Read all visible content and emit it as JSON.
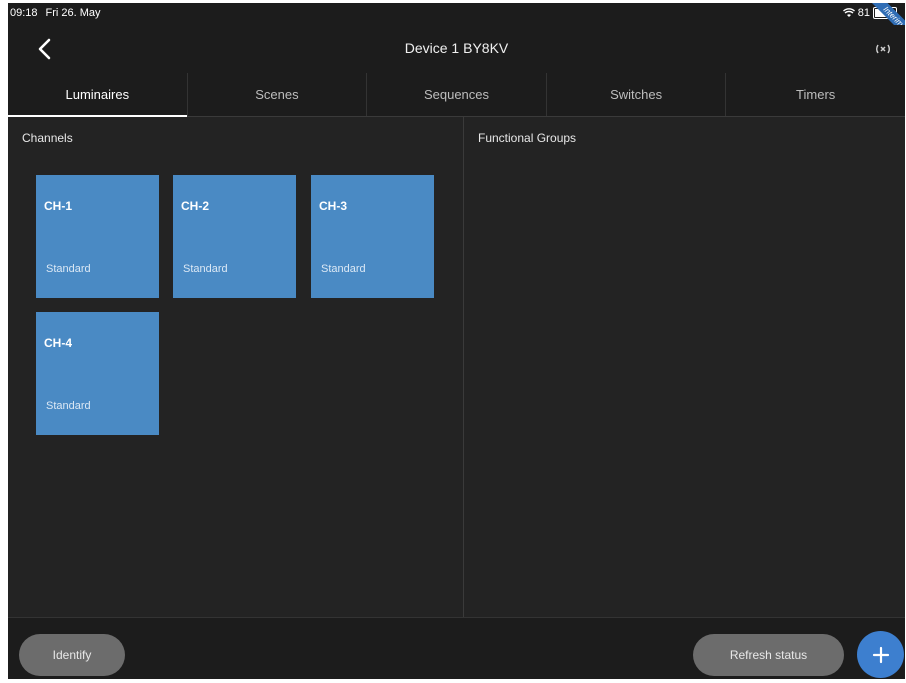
{
  "status_bar": {
    "time": "09:18",
    "date": "Fri 26. May",
    "battery": "81",
    "banner": "Interim"
  },
  "header": {
    "title": "Device 1 BY8KV"
  },
  "tabs": [
    {
      "label": "Luminaires",
      "active": true
    },
    {
      "label": "Scenes",
      "active": false
    },
    {
      "label": "Sequences",
      "active": false
    },
    {
      "label": "Switches",
      "active": false
    },
    {
      "label": "Timers",
      "active": false
    }
  ],
  "channels": {
    "title": "Channels",
    "items": [
      {
        "name": "CH-1",
        "type": "Standard"
      },
      {
        "name": "CH-2",
        "type": "Standard"
      },
      {
        "name": "CH-3",
        "type": "Standard"
      },
      {
        "name": "CH-4",
        "type": "Standard"
      }
    ]
  },
  "functional_groups": {
    "title": "Functional Groups"
  },
  "bottom": {
    "identify_label": "Identify",
    "refresh_label": "Refresh status",
    "add_label": "+"
  },
  "colors": {
    "background": "#232323",
    "bar": "#1c1c1c",
    "tile": "#4a8ac4",
    "pill": "#6c6c6c",
    "fab": "#3d7fcf"
  }
}
